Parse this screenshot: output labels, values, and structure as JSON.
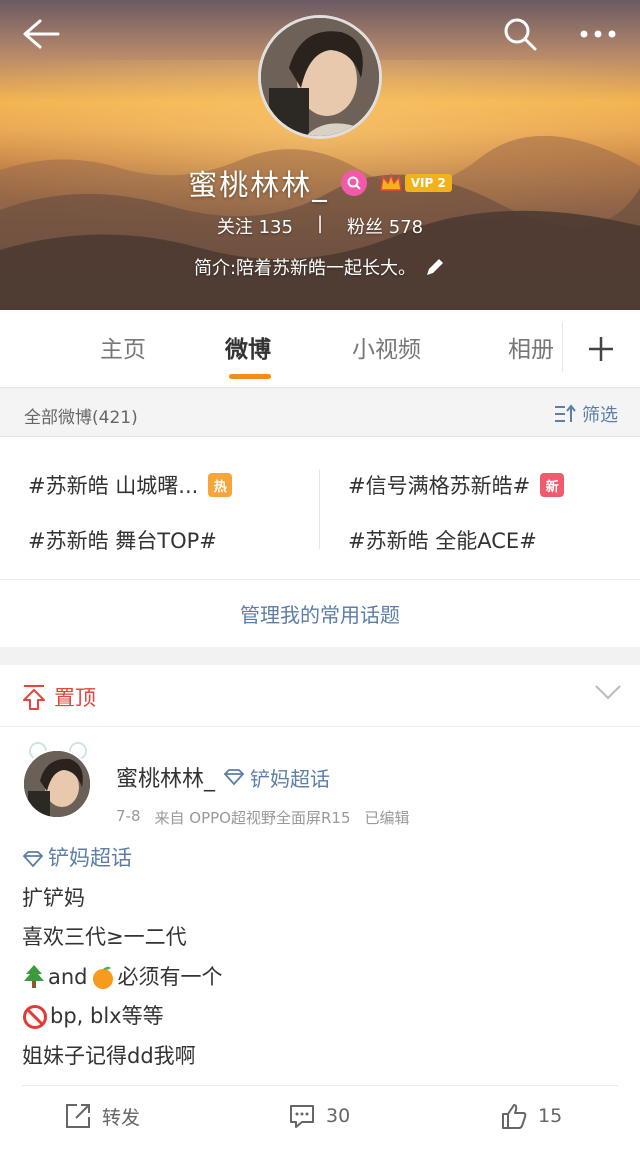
{
  "profile": {
    "name": "蜜桃林林_",
    "vip_label": "VIP 2",
    "follow_label": "关注",
    "follow_count": "135",
    "separator": "|",
    "fans_label": "粉丝",
    "fans_count": "578",
    "bio": "简介:陪着苏新皓一起长大。"
  },
  "tabs": [
    "主页",
    "微博",
    "小视频",
    "相册"
  ],
  "filter": {
    "all_label": "全部微博(421)",
    "sift_label": "筛选"
  },
  "topics": [
    {
      "text": "#苏新皓 山城曙...",
      "tag": "热"
    },
    {
      "text": "#信号满格苏新皓#",
      "tag": "新"
    },
    {
      "text": "#苏新皓 舞台TOP#",
      "tag": ""
    },
    {
      "text": "#苏新皓 全能ACE#",
      "tag": ""
    }
  ],
  "manage_label": "管理我的常用话题",
  "pinned_label": "置顶",
  "post": {
    "author": "蜜桃林林_",
    "supertopic": "铲妈超话",
    "date": "7-8",
    "source": "来自 OPPO超视野全面屏R15",
    "edited": "已编辑",
    "body_supertopic": "铲妈超话",
    "lines": [
      "扩铲妈",
      "喜欢三代≥一二代",
      "and",
      "必须有一个",
      "bp, blx等等",
      "姐妹子记得dd我啊"
    ],
    "repost_label": "转发",
    "comment_count": "30",
    "like_count": "15"
  },
  "colors": {
    "accent": "#f28c1c",
    "link": "#5d7ea8",
    "pinned": "#e8443b",
    "vip": "#f4b21a"
  },
  "icons": [
    "back-arrow-icon",
    "search-icon",
    "more-icon",
    "verify-search-icon",
    "crown-icon",
    "edit-pencil-icon",
    "plus-icon",
    "filter-icon",
    "pin-top-icon",
    "chevron-down-icon",
    "diamond-icon",
    "tree-emoji",
    "orange-emoji",
    "no-entry-emoji",
    "repost-icon",
    "comment-icon",
    "like-icon"
  ]
}
